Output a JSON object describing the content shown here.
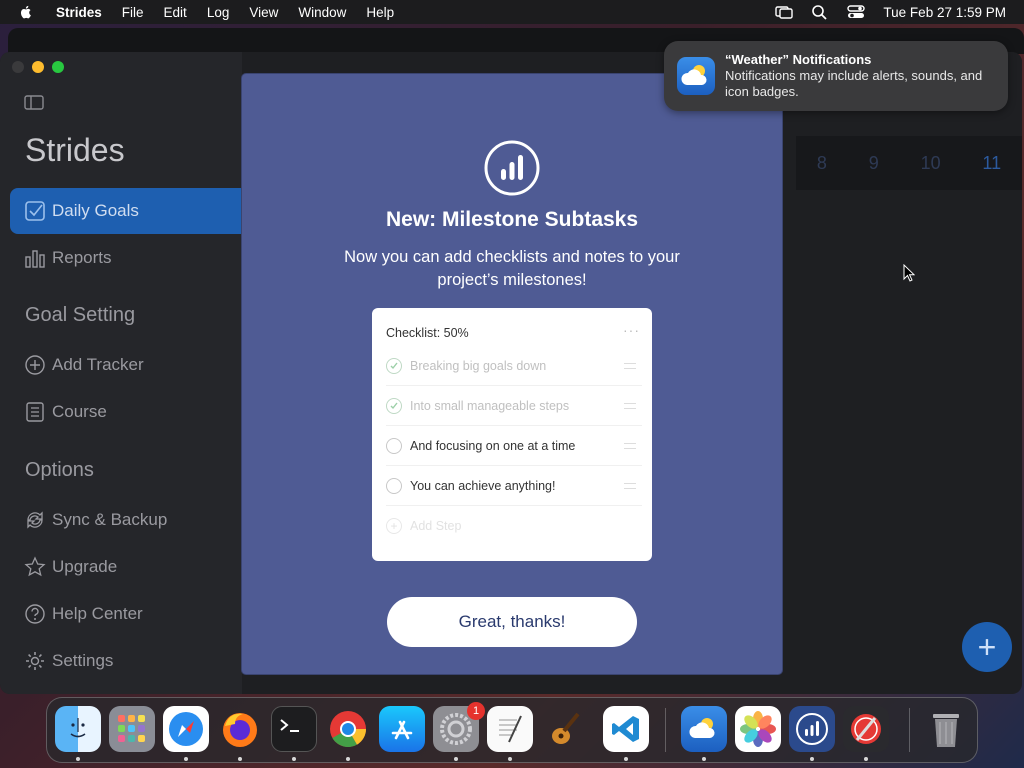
{
  "menubar": {
    "app_name": "Strides",
    "items": [
      "File",
      "Edit",
      "Log",
      "View",
      "Window",
      "Help"
    ],
    "datetime": "Tue Feb 27  1:59 PM"
  },
  "sidebar": {
    "title": "Strides",
    "nav": [
      {
        "label": "Daily Goals",
        "icon": "checkbox-icon",
        "active": true
      },
      {
        "label": "Reports",
        "icon": "bar-chart-icon",
        "active": false
      }
    ],
    "goal_setting_header": "Goal Setting",
    "goal_setting": [
      {
        "label": "Add Tracker",
        "icon": "plus-circle-icon"
      },
      {
        "label": "Course",
        "icon": "document-icon"
      }
    ],
    "options_header": "Options",
    "options": [
      {
        "label": "Sync & Backup",
        "icon": "sync-icon"
      },
      {
        "label": "Upgrade",
        "icon": "star-icon"
      },
      {
        "label": "Help Center",
        "icon": "question-icon"
      },
      {
        "label": "Settings",
        "icon": "gear-icon"
      }
    ]
  },
  "calendar": {
    "days": [
      "8",
      "9",
      "10"
    ],
    "today": "11"
  },
  "modal": {
    "title": "New: Milestone Subtasks",
    "body": "Now you can add checklists and notes to your project’s milestones!",
    "card": {
      "header": "Checklist: 50%",
      "steps": [
        {
          "label": "Breaking big goals down",
          "done": true
        },
        {
          "label": "Into small manageable steps",
          "done": true
        },
        {
          "label": "And focusing on one at a time",
          "done": false
        },
        {
          "label": "You can achieve anything!",
          "done": false
        }
      ],
      "add_step": "Add Step"
    },
    "button": "Great, thanks!"
  },
  "notification": {
    "title": "“Weather” Notifications",
    "text": "Notifications may include alerts, sounds, and icon badges."
  },
  "dock": {
    "apps": [
      "finder",
      "launchpad",
      "safari",
      "firefox",
      "terminal",
      "chrome",
      "app-store",
      "system-settings",
      "textedit",
      "garageband",
      "vscode",
      "weather",
      "photos",
      "strides",
      "instruments",
      "trash"
    ],
    "settings_badge": "1"
  },
  "colors": {
    "accent": "#1e5fb0",
    "modal_bg": "#4f5b94",
    "sidebar_bg": "#25262a"
  }
}
